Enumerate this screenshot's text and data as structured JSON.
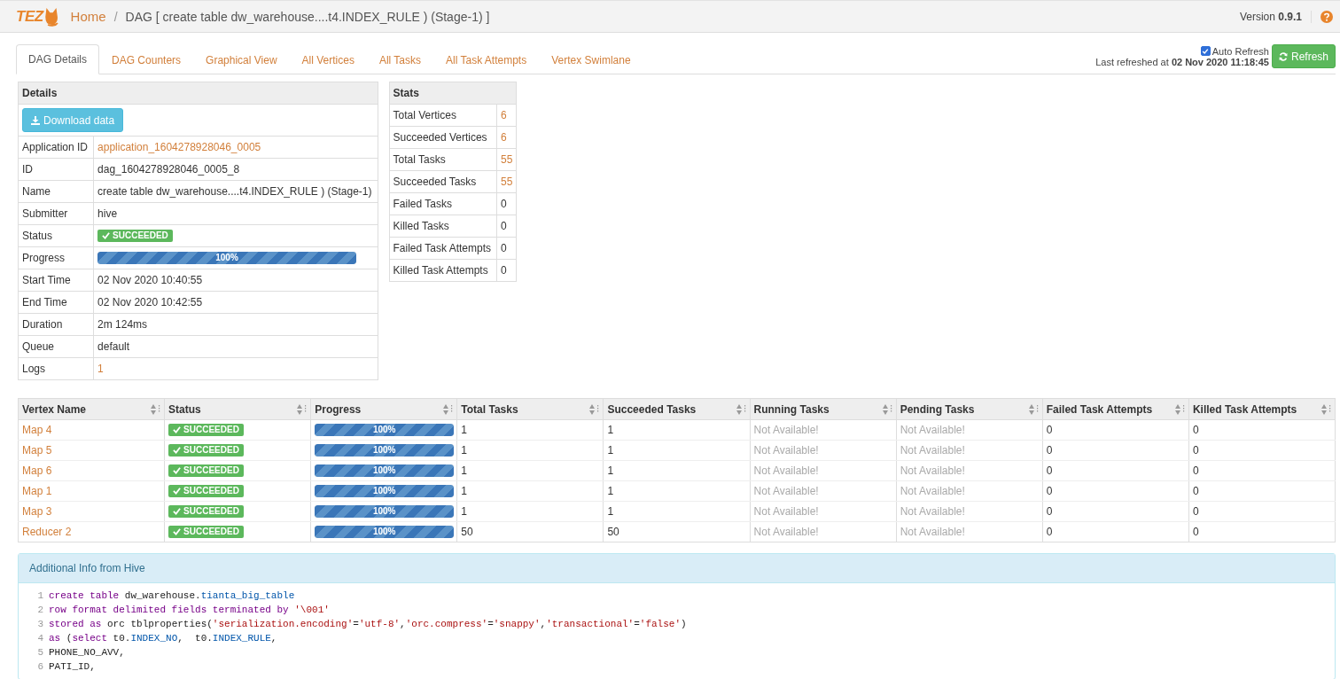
{
  "app": {
    "logo": "TEZ",
    "breadcrumb": [
      {
        "label": "Home",
        "kind": "link"
      },
      {
        "label": "DAG [ create table dw_warehouse....t4.INDEX_RULE ) (Stage-1) ]",
        "kind": "current"
      }
    ],
    "separator": "/",
    "version_label": "Version",
    "version": "0.9.1"
  },
  "tabs": [
    {
      "label": "DAG Details",
      "selected": true
    },
    {
      "label": "DAG Counters",
      "selected": false
    },
    {
      "label": "Graphical View",
      "selected": false
    },
    {
      "label": "All Vertices",
      "selected": false
    },
    {
      "label": "All Tasks",
      "selected": false
    },
    {
      "label": "All Task Attempts",
      "selected": false
    },
    {
      "label": "Vertex Swimlane",
      "selected": false
    }
  ],
  "refresh": {
    "auto_refresh_label": "Auto Refresh",
    "auto_refresh": true,
    "last_refreshed_label": "Last refreshed at",
    "last_refreshed": "02 Nov 2020 11:18:45",
    "button": "Refresh"
  },
  "details": {
    "title": "Details",
    "download_button": "Download data",
    "rows": [
      {
        "label": "Application ID",
        "kind": "link",
        "value": "application_1604278928046_0005"
      },
      {
        "label": "ID",
        "kind": "text",
        "value": "dag_1604278928046_0005_8"
      },
      {
        "label": "Name",
        "kind": "text",
        "value": "create table dw_warehouse....t4.INDEX_RULE ) (Stage-1)"
      },
      {
        "label": "Submitter",
        "kind": "text",
        "value": "hive"
      },
      {
        "label": "Status",
        "kind": "status",
        "value": "SUCCEEDED"
      },
      {
        "label": "Progress",
        "kind": "progress",
        "value": "100%",
        "level": 1
      },
      {
        "label": "Start Time",
        "kind": "text",
        "value": "02 Nov 2020 10:40:55"
      },
      {
        "label": "End Time",
        "kind": "text",
        "value": "02 Nov 2020 10:42:55"
      },
      {
        "label": "Duration",
        "kind": "text",
        "value": "2m 124ms"
      },
      {
        "label": "Queue",
        "kind": "text",
        "value": "default"
      },
      {
        "label": "Logs",
        "kind": "link",
        "value": "1"
      }
    ]
  },
  "stats": {
    "title": "Stats",
    "rows": [
      {
        "label": "Total Vertices",
        "kind": "link",
        "value": "6"
      },
      {
        "label": "Succeeded Vertices",
        "kind": "link",
        "value": "6"
      },
      {
        "label": "Total Tasks",
        "kind": "link",
        "value": "55"
      },
      {
        "label": "Succeeded Tasks",
        "kind": "link",
        "value": "55"
      },
      {
        "label": "Failed Tasks",
        "kind": "text",
        "value": "0"
      },
      {
        "label": "Killed Tasks",
        "kind": "text",
        "value": "0"
      },
      {
        "label": "Failed Task Attempts",
        "kind": "text",
        "value": "0"
      },
      {
        "label": "Killed Task Attempts",
        "kind": "text",
        "value": "0"
      }
    ]
  },
  "vertices": {
    "columns": [
      "Vertex Name",
      "Status",
      "Progress",
      "Total Tasks",
      "Succeeded Tasks",
      "Running Tasks",
      "Pending Tasks",
      "Failed Task Attempts",
      "Killed Task Attempts"
    ],
    "rows": [
      {
        "cells": [
          {
            "kind": "link",
            "text": "Map 4"
          },
          {
            "kind": "status",
            "text": "SUCCEEDED"
          },
          {
            "kind": "progress",
            "text": "100%",
            "level": 1
          },
          {
            "kind": "text",
            "text": "1"
          },
          {
            "kind": "text",
            "text": "1"
          },
          {
            "kind": "na",
            "text": "Not Available!"
          },
          {
            "kind": "na",
            "text": "Not Available!"
          },
          {
            "kind": "text",
            "text": "0"
          },
          {
            "kind": "text",
            "text": "0"
          }
        ]
      },
      {
        "cells": [
          {
            "kind": "link",
            "text": "Map 5"
          },
          {
            "kind": "status",
            "text": "SUCCEEDED"
          },
          {
            "kind": "progress",
            "text": "100%",
            "level": 1
          },
          {
            "kind": "text",
            "text": "1"
          },
          {
            "kind": "text",
            "text": "1"
          },
          {
            "kind": "na",
            "text": "Not Available!"
          },
          {
            "kind": "na",
            "text": "Not Available!"
          },
          {
            "kind": "text",
            "text": "0"
          },
          {
            "kind": "text",
            "text": "0"
          }
        ]
      },
      {
        "cells": [
          {
            "kind": "link",
            "text": "Map 6"
          },
          {
            "kind": "status",
            "text": "SUCCEEDED"
          },
          {
            "kind": "progress",
            "text": "100%",
            "level": 1
          },
          {
            "kind": "text",
            "text": "1"
          },
          {
            "kind": "text",
            "text": "1"
          },
          {
            "kind": "na",
            "text": "Not Available!"
          },
          {
            "kind": "na",
            "text": "Not Available!"
          },
          {
            "kind": "text",
            "text": "0"
          },
          {
            "kind": "text",
            "text": "0"
          }
        ]
      },
      {
        "cells": [
          {
            "kind": "link",
            "text": "Map 1"
          },
          {
            "kind": "status",
            "text": "SUCCEEDED"
          },
          {
            "kind": "progress",
            "text": "100%",
            "level": 1
          },
          {
            "kind": "text",
            "text": "1"
          },
          {
            "kind": "text",
            "text": "1"
          },
          {
            "kind": "na",
            "text": "Not Available!"
          },
          {
            "kind": "na",
            "text": "Not Available!"
          },
          {
            "kind": "text",
            "text": "0"
          },
          {
            "kind": "text",
            "text": "0"
          }
        ]
      },
      {
        "cells": [
          {
            "kind": "link",
            "text": "Map 3"
          },
          {
            "kind": "status",
            "text": "SUCCEEDED"
          },
          {
            "kind": "progress",
            "text": "100%",
            "level": 1
          },
          {
            "kind": "text",
            "text": "1"
          },
          {
            "kind": "text",
            "text": "1"
          },
          {
            "kind": "na",
            "text": "Not Available!"
          },
          {
            "kind": "na",
            "text": "Not Available!"
          },
          {
            "kind": "text",
            "text": "0"
          },
          {
            "kind": "text",
            "text": "0"
          }
        ]
      },
      {
        "cells": [
          {
            "kind": "link",
            "text": "Reducer 2"
          },
          {
            "kind": "status",
            "text": "SUCCEEDED"
          },
          {
            "kind": "progress",
            "text": "100%",
            "level": 1
          },
          {
            "kind": "text",
            "text": "50"
          },
          {
            "kind": "text",
            "text": "50"
          },
          {
            "kind": "na",
            "text": "Not Available!"
          },
          {
            "kind": "na",
            "text": "Not Available!"
          },
          {
            "kind": "text",
            "text": "0"
          },
          {
            "kind": "text",
            "text": "0"
          }
        ]
      }
    ]
  },
  "hive_info": {
    "title": "Additional Info from Hive",
    "lines": [
      {
        "number": "1",
        "tokens": [
          {
            "kind": "keyword",
            "text": "create table"
          },
          {
            "kind": "plain",
            "text": " dw_warehouse."
          },
          {
            "kind": "variable",
            "text": "tianta_big_table"
          }
        ]
      },
      {
        "number": "2",
        "tokens": [
          {
            "kind": "keyword",
            "text": "row format delimited fields terminated by "
          },
          {
            "kind": "string",
            "text": "'\\001'"
          }
        ]
      },
      {
        "number": "3",
        "tokens": [
          {
            "kind": "keyword",
            "text": "stored as"
          },
          {
            "kind": "plain",
            "text": " orc tblproperties("
          },
          {
            "kind": "string",
            "text": "'serialization.encoding'"
          },
          {
            "kind": "plain",
            "text": "="
          },
          {
            "kind": "string",
            "text": "'utf-8'"
          },
          {
            "kind": "plain",
            "text": ","
          },
          {
            "kind": "string",
            "text": "'orc.compress'"
          },
          {
            "kind": "plain",
            "text": "="
          },
          {
            "kind": "string",
            "text": "'snappy'"
          },
          {
            "kind": "plain",
            "text": ","
          },
          {
            "kind": "string",
            "text": "'transactional'"
          },
          {
            "kind": "plain",
            "text": "="
          },
          {
            "kind": "string",
            "text": "'false'"
          },
          {
            "kind": "plain",
            "text": ")"
          }
        ]
      },
      {
        "number": "4",
        "tokens": [
          {
            "kind": "keyword",
            "text": "as"
          },
          {
            "kind": "plain",
            "text": " ("
          },
          {
            "kind": "keyword",
            "text": "select"
          },
          {
            "kind": "plain",
            "text": " t0."
          },
          {
            "kind": "variable",
            "text": "INDEX_NO"
          },
          {
            "kind": "plain",
            "text": ",  t0."
          },
          {
            "kind": "variable",
            "text": "INDEX_RULE"
          },
          {
            "kind": "plain",
            "text": ","
          }
        ]
      },
      {
        "number": "5",
        "tokens": [
          {
            "kind": "plain",
            "text": "PHONE_NO_AVV,"
          }
        ]
      },
      {
        "number": "6",
        "tokens": [
          {
            "kind": "plain",
            "text": "PATI_ID,"
          }
        ]
      }
    ]
  }
}
